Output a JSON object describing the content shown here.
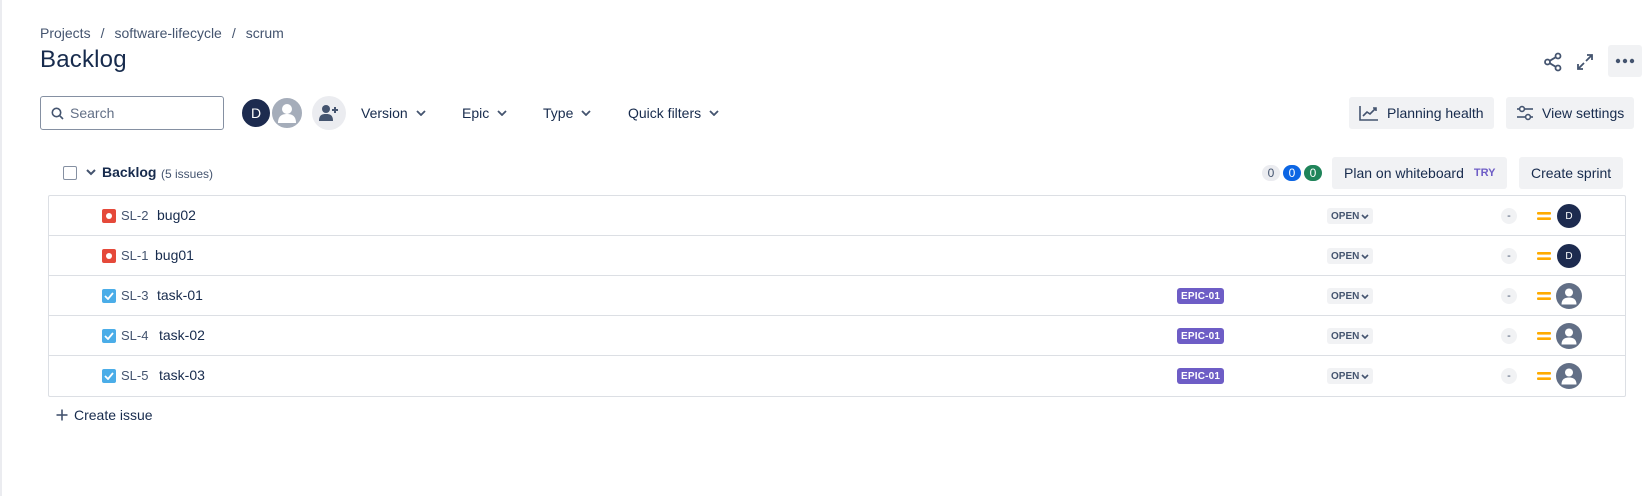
{
  "breadcrumb": {
    "items": [
      "Projects",
      "software-lifecycle",
      "scrum"
    ],
    "separator": "/"
  },
  "page": {
    "title": "Backlog"
  },
  "header_icons": [
    "share-icon",
    "fullscreen-icon",
    "more-icon"
  ],
  "toolbar": {
    "search_placeholder": "Search",
    "avatars": [
      {
        "initial": "D",
        "color": "#1d2b4f"
      },
      {
        "icon": "default-user-icon",
        "color": "#a5adba"
      }
    ],
    "add_people_icon": "add-people-icon",
    "filters": [
      "Version",
      "Epic",
      "Type",
      "Quick filters"
    ],
    "planning_health_label": "Planning health",
    "view_settings_label": "View settings"
  },
  "backlog": {
    "title": "Backlog",
    "count_label": "(5 issues)",
    "counts": {
      "todo": "0",
      "in_progress": "0",
      "done": "0"
    },
    "plan_on_whiteboard_label": "Plan on whiteboard",
    "try_label": "TRY",
    "create_sprint_label": "Create sprint"
  },
  "issues": [
    {
      "type": "bug",
      "key": "SL-2",
      "summary": "bug02",
      "epic": "",
      "status": "OPEN",
      "estimate": "-",
      "priority": "medium",
      "assignee": "D"
    },
    {
      "type": "bug",
      "key": "SL-1",
      "summary": "bug01",
      "epic": "",
      "status": "OPEN",
      "estimate": "-",
      "priority": "medium",
      "assignee": "D"
    },
    {
      "type": "task",
      "key": "SL-3",
      "summary": "task-01",
      "epic": "EPIC-01",
      "status": "OPEN",
      "estimate": "-",
      "priority": "medium",
      "assignee": ""
    },
    {
      "type": "task",
      "key": "SL-4",
      "summary": "task-02",
      "epic": "EPIC-01",
      "status": "OPEN",
      "estimate": "-",
      "priority": "medium",
      "assignee": ""
    },
    {
      "type": "task",
      "key": "SL-5",
      "summary": "task-03",
      "epic": "EPIC-01",
      "status": "OPEN",
      "estimate": "-",
      "priority": "medium",
      "assignee": ""
    }
  ],
  "create_issue_label": "Create issue",
  "colors": {
    "epic": "#6e5dc6",
    "bug": "#e5493a",
    "task": "#4bade8",
    "priority_medium": "#ffab00",
    "count_blue": "#0c66e4",
    "count_green": "#1f845a"
  }
}
